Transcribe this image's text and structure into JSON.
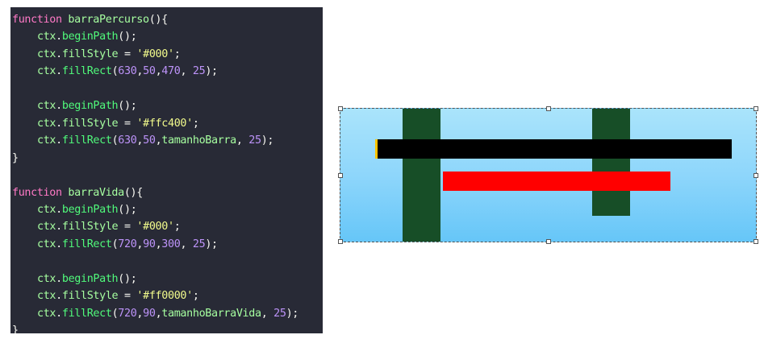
{
  "theme": {
    "editor_bg": "#282a36",
    "keyword": "#ff79c6",
    "function_name": "#a6ffa0",
    "plain": "#f8f8f2",
    "method": "#50fa7b",
    "string": "#f1fa8c",
    "number": "#bd93f9",
    "brace": "#f8f8f2"
  },
  "code": {
    "lines": [
      {
        "indent": 0,
        "tokens": [
          {
            "t": "function",
            "c": "keyword"
          },
          {
            "t": " ",
            "c": "plain"
          },
          {
            "t": "barraPercurso",
            "c": "function_name"
          },
          {
            "t": "(){",
            "c": "plain"
          }
        ]
      },
      {
        "indent": 1,
        "tokens": [
          {
            "t": "ctx",
            "c": "function_name"
          },
          {
            "t": ".",
            "c": "plain"
          },
          {
            "t": "beginPath",
            "c": "method"
          },
          {
            "t": "();",
            "c": "plain"
          }
        ]
      },
      {
        "indent": 1,
        "tokens": [
          {
            "t": "ctx",
            "c": "function_name"
          },
          {
            "t": ".",
            "c": "plain"
          },
          {
            "t": "fillStyle",
            "c": "function_name"
          },
          {
            "t": " = ",
            "c": "plain"
          },
          {
            "t": "'#000'",
            "c": "string"
          },
          {
            "t": ";",
            "c": "plain"
          }
        ]
      },
      {
        "indent": 1,
        "tokens": [
          {
            "t": "ctx",
            "c": "function_name"
          },
          {
            "t": ".",
            "c": "plain"
          },
          {
            "t": "fillRect",
            "c": "method"
          },
          {
            "t": "(",
            "c": "plain"
          },
          {
            "t": "630",
            "c": "number"
          },
          {
            "t": ",",
            "c": "plain"
          },
          {
            "t": "50",
            "c": "number"
          },
          {
            "t": ",",
            "c": "plain"
          },
          {
            "t": "470",
            "c": "number"
          },
          {
            "t": ", ",
            "c": "plain"
          },
          {
            "t": "25",
            "c": "number"
          },
          {
            "t": ");",
            "c": "plain"
          }
        ]
      },
      {
        "indent": 0,
        "tokens": []
      },
      {
        "indent": 1,
        "tokens": [
          {
            "t": "ctx",
            "c": "function_name"
          },
          {
            "t": ".",
            "c": "plain"
          },
          {
            "t": "beginPath",
            "c": "method"
          },
          {
            "t": "();",
            "c": "plain"
          }
        ]
      },
      {
        "indent": 1,
        "tokens": [
          {
            "t": "ctx",
            "c": "function_name"
          },
          {
            "t": ".",
            "c": "plain"
          },
          {
            "t": "fillStyle",
            "c": "function_name"
          },
          {
            "t": " = ",
            "c": "plain"
          },
          {
            "t": "'#ffc400'",
            "c": "string"
          },
          {
            "t": ";",
            "c": "plain"
          }
        ]
      },
      {
        "indent": 1,
        "tokens": [
          {
            "t": "ctx",
            "c": "function_name"
          },
          {
            "t": ".",
            "c": "plain"
          },
          {
            "t": "fillRect",
            "c": "method"
          },
          {
            "t": "(",
            "c": "plain"
          },
          {
            "t": "630",
            "c": "number"
          },
          {
            "t": ",",
            "c": "plain"
          },
          {
            "t": "50",
            "c": "number"
          },
          {
            "t": ",",
            "c": "plain"
          },
          {
            "t": "tamanhoBarra",
            "c": "function_name"
          },
          {
            "t": ", ",
            "c": "plain"
          },
          {
            "t": "25",
            "c": "number"
          },
          {
            "t": ");",
            "c": "plain"
          }
        ]
      },
      {
        "indent": 0,
        "tokens": [
          {
            "t": "}",
            "c": "brace"
          }
        ]
      },
      {
        "indent": 0,
        "tokens": []
      },
      {
        "indent": 0,
        "tokens": [
          {
            "t": "function",
            "c": "keyword"
          },
          {
            "t": " ",
            "c": "plain"
          },
          {
            "t": "barraVida",
            "c": "function_name"
          },
          {
            "t": "(){",
            "c": "plain"
          }
        ]
      },
      {
        "indent": 1,
        "tokens": [
          {
            "t": "ctx",
            "c": "function_name"
          },
          {
            "t": ".",
            "c": "plain"
          },
          {
            "t": "beginPath",
            "c": "method"
          },
          {
            "t": "();",
            "c": "plain"
          }
        ]
      },
      {
        "indent": 1,
        "tokens": [
          {
            "t": "ctx",
            "c": "function_name"
          },
          {
            "t": ".",
            "c": "plain"
          },
          {
            "t": "fillStyle",
            "c": "function_name"
          },
          {
            "t": " = ",
            "c": "plain"
          },
          {
            "t": "'#000'",
            "c": "string"
          },
          {
            "t": ";",
            "c": "plain"
          }
        ]
      },
      {
        "indent": 1,
        "tokens": [
          {
            "t": "ctx",
            "c": "function_name"
          },
          {
            "t": ".",
            "c": "plain"
          },
          {
            "t": "fillRect",
            "c": "method"
          },
          {
            "t": "(",
            "c": "plain"
          },
          {
            "t": "720",
            "c": "number"
          },
          {
            "t": ",",
            "c": "plain"
          },
          {
            "t": "90",
            "c": "number"
          },
          {
            "t": ",",
            "c": "plain"
          },
          {
            "t": "300",
            "c": "number"
          },
          {
            "t": ", ",
            "c": "plain"
          },
          {
            "t": "25",
            "c": "number"
          },
          {
            "t": ");",
            "c": "plain"
          }
        ]
      },
      {
        "indent": 0,
        "tokens": []
      },
      {
        "indent": 1,
        "tokens": [
          {
            "t": "ctx",
            "c": "function_name"
          },
          {
            "t": ".",
            "c": "plain"
          },
          {
            "t": "beginPath",
            "c": "method"
          },
          {
            "t": "();",
            "c": "plain"
          }
        ]
      },
      {
        "indent": 1,
        "tokens": [
          {
            "t": "ctx",
            "c": "function_name"
          },
          {
            "t": ".",
            "c": "plain"
          },
          {
            "t": "fillStyle",
            "c": "function_name"
          },
          {
            "t": " = ",
            "c": "plain"
          },
          {
            "t": "'#ff0000'",
            "c": "string"
          },
          {
            "t": ";",
            "c": "plain"
          }
        ]
      },
      {
        "indent": 1,
        "tokens": [
          {
            "t": "ctx",
            "c": "function_name"
          },
          {
            "t": ".",
            "c": "plain"
          },
          {
            "t": "fillRect",
            "c": "method"
          },
          {
            "t": "(",
            "c": "plain"
          },
          {
            "t": "720",
            "c": "number"
          },
          {
            "t": ",",
            "c": "plain"
          },
          {
            "t": "90",
            "c": "number"
          },
          {
            "t": ",",
            "c": "plain"
          },
          {
            "t": "tamanhoBarraVida",
            "c": "function_name"
          },
          {
            "t": ", ",
            "c": "plain"
          },
          {
            "t": "25",
            "c": "number"
          },
          {
            "t": ");",
            "c": "plain"
          }
        ]
      },
      {
        "indent": 0,
        "tokens": [
          {
            "t": "}",
            "c": "brace"
          }
        ]
      }
    ]
  },
  "canvas_preview": {
    "sky_top": "#aae4fb",
    "sky_bottom": "#66c6f8",
    "pillar_color": "#174e27",
    "track_bar_color": "#000000",
    "progress_bar_color": "#ffc400",
    "health_bar_color": "#ff0000",
    "track_progress_fraction": 0.006,
    "health_fraction": 0.94
  }
}
